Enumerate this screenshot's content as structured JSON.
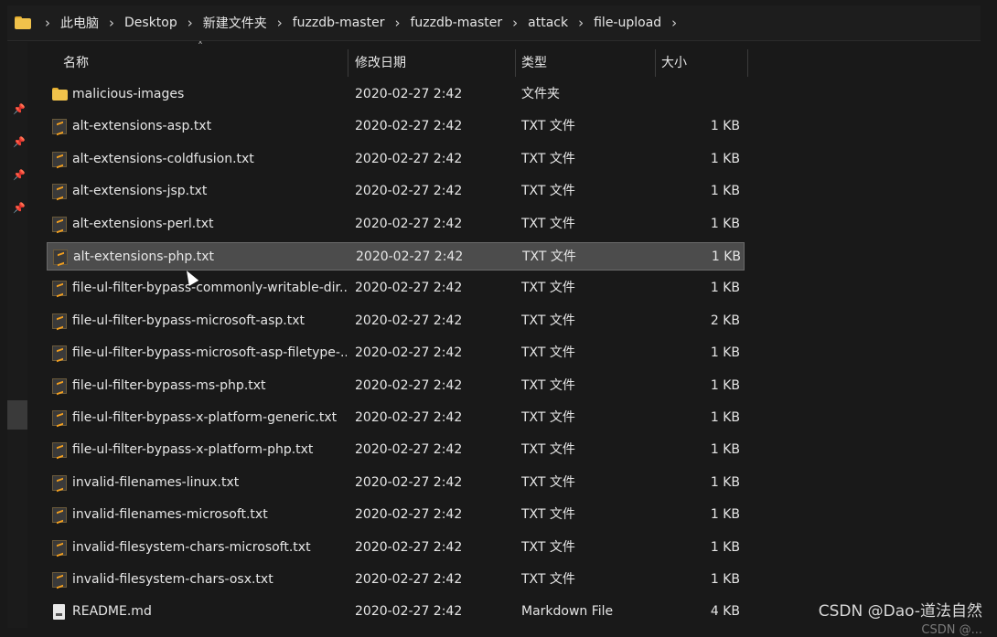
{
  "breadcrumb": {
    "items": [
      "此电脑",
      "Desktop",
      "新建文件夹",
      "fuzzdb-master",
      "fuzzdb-master",
      "attack",
      "file-upload"
    ],
    "separator": "›"
  },
  "columns": {
    "name": "名称",
    "date": "修改日期",
    "type": "类型",
    "size": "大小"
  },
  "files": [
    {
      "name": "malicious-images",
      "date": "2020-02-27 2:42",
      "type": "文件夹",
      "size": "",
      "icon": "folder-icon"
    },
    {
      "name": "alt-extensions-asp.txt",
      "date": "2020-02-27 2:42",
      "type": "TXT 文件",
      "size": "1 KB",
      "icon": "sublime-file-icon"
    },
    {
      "name": "alt-extensions-coldfusion.txt",
      "date": "2020-02-27 2:42",
      "type": "TXT 文件",
      "size": "1 KB",
      "icon": "sublime-file-icon"
    },
    {
      "name": "alt-extensions-jsp.txt",
      "date": "2020-02-27 2:42",
      "type": "TXT 文件",
      "size": "1 KB",
      "icon": "sublime-file-icon"
    },
    {
      "name": "alt-extensions-perl.txt",
      "date": "2020-02-27 2:42",
      "type": "TXT 文件",
      "size": "1 KB",
      "icon": "sublime-file-icon"
    },
    {
      "name": "alt-extensions-php.txt",
      "date": "2020-02-27 2:42",
      "type": "TXT 文件",
      "size": "1 KB",
      "icon": "sublime-file-icon",
      "selected": true
    },
    {
      "name": "file-ul-filter-bypass-commonly-writable-dir...",
      "date": "2020-02-27 2:42",
      "type": "TXT 文件",
      "size": "1 KB",
      "icon": "sublime-file-icon"
    },
    {
      "name": "file-ul-filter-bypass-microsoft-asp.txt",
      "date": "2020-02-27 2:42",
      "type": "TXT 文件",
      "size": "2 KB",
      "icon": "sublime-file-icon"
    },
    {
      "name": "file-ul-filter-bypass-microsoft-asp-filetype-...",
      "date": "2020-02-27 2:42",
      "type": "TXT 文件",
      "size": "1 KB",
      "icon": "sublime-file-icon"
    },
    {
      "name": "file-ul-filter-bypass-ms-php.txt",
      "date": "2020-02-27 2:42",
      "type": "TXT 文件",
      "size": "1 KB",
      "icon": "sublime-file-icon"
    },
    {
      "name": "file-ul-filter-bypass-x-platform-generic.txt",
      "date": "2020-02-27 2:42",
      "type": "TXT 文件",
      "size": "1 KB",
      "icon": "sublime-file-icon"
    },
    {
      "name": "file-ul-filter-bypass-x-platform-php.txt",
      "date": "2020-02-27 2:42",
      "type": "TXT 文件",
      "size": "1 KB",
      "icon": "sublime-file-icon"
    },
    {
      "name": "invalid-filenames-linux.txt",
      "date": "2020-02-27 2:42",
      "type": "TXT 文件",
      "size": "1 KB",
      "icon": "sublime-file-icon"
    },
    {
      "name": "invalid-filenames-microsoft.txt",
      "date": "2020-02-27 2:42",
      "type": "TXT 文件",
      "size": "1 KB",
      "icon": "sublime-file-icon"
    },
    {
      "name": "invalid-filesystem-chars-microsoft.txt",
      "date": "2020-02-27 2:42",
      "type": "TXT 文件",
      "size": "1 KB",
      "icon": "sublime-file-icon"
    },
    {
      "name": "invalid-filesystem-chars-osx.txt",
      "date": "2020-02-27 2:42",
      "type": "TXT 文件",
      "size": "1 KB",
      "icon": "sublime-file-icon"
    },
    {
      "name": "README.md",
      "date": "2020-02-27 2:42",
      "type": "Markdown File",
      "size": "4 KB",
      "icon": "markdown-file-icon"
    }
  ],
  "watermark": "CSDN @Dao-道法自然",
  "watermark_partial": "CSDN @...",
  "colors": {
    "background": "#191919",
    "selected_row": "#4c4c4c",
    "folder": "#f0c24b",
    "sublime": "#f29f1f"
  }
}
